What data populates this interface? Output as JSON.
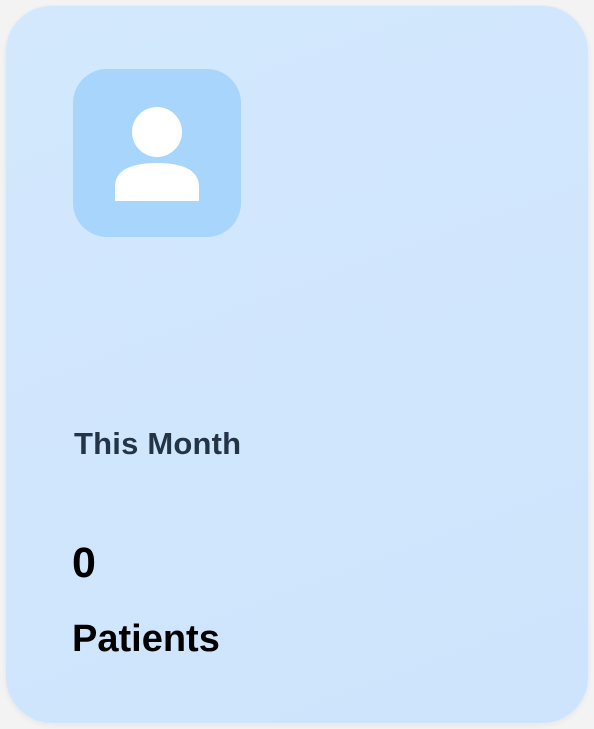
{
  "card": {
    "icon": "user-icon",
    "period_label": "This Month",
    "count": "0",
    "unit_label": "Patients"
  },
  "colors": {
    "card_background": "#d1e7fd",
    "icon_tile_background": "#a8d5fc",
    "icon_fill": "#ffffff",
    "label_color": "#243447",
    "value_color": "#000000"
  }
}
